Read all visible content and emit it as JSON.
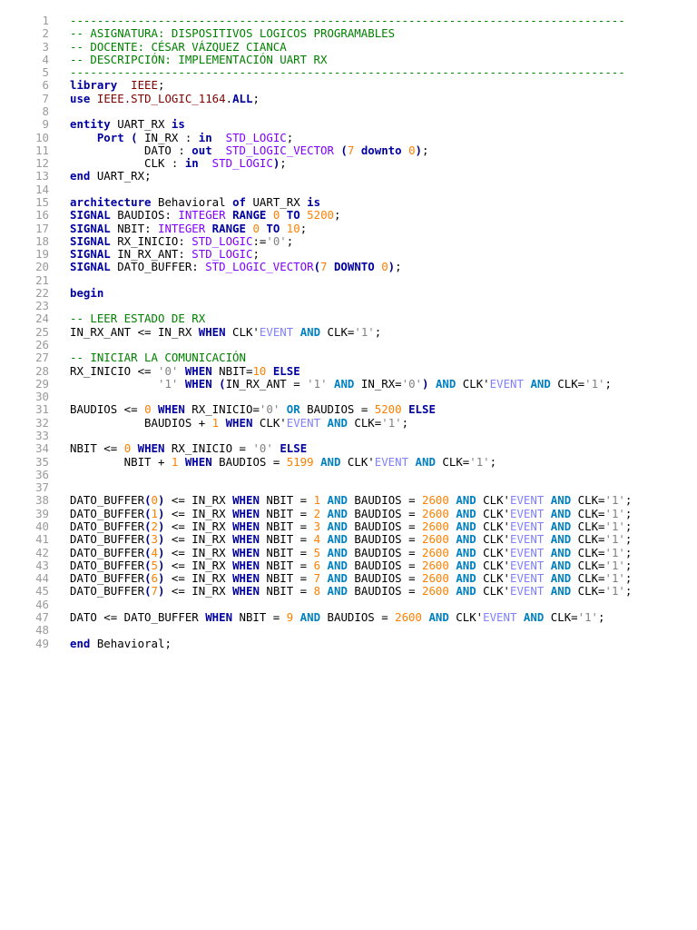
{
  "lines": [
    [
      [
        "c",
        "----------------------------------------------------------------------------------"
      ]
    ],
    [
      [
        "c",
        "-- ASIGNATURA: DISPOSITIVOS LOGICOS PROGRAMABLES"
      ]
    ],
    [
      [
        "c",
        "-- DOCENTE: CÉSAR VÁZQUEZ CIANCA"
      ]
    ],
    [
      [
        "c",
        "-- DESCRIPCIÓN: IMPLEMENTACIÓN UART RX"
      ]
    ],
    [
      [
        "c",
        "----------------------------------------------------------------------------------"
      ]
    ],
    [
      [
        "k",
        "library"
      ],
      [
        "",
        "  "
      ],
      [
        "l",
        "IEEE"
      ],
      [
        "",
        ";"
      ]
    ],
    [
      [
        "k",
        "use"
      ],
      [
        "",
        " "
      ],
      [
        "l",
        "IEEE.STD_LOGIC_1164"
      ],
      [
        "",
        "."
      ],
      [
        "k",
        "ALL"
      ],
      [
        "",
        ";"
      ]
    ],
    [],
    [
      [
        "k",
        "entity"
      ],
      [
        "",
        " UART_RX "
      ],
      [
        "k",
        "is"
      ]
    ],
    [
      [
        "",
        "    "
      ],
      [
        "k",
        "Port"
      ],
      [
        "",
        " "
      ],
      [
        "p",
        "("
      ],
      [
        "",
        " IN_RX : "
      ],
      [
        "k",
        "in"
      ],
      [
        "",
        "  "
      ],
      [
        "t",
        "STD_LOGIC"
      ],
      [
        "",
        ";"
      ]
    ],
    [
      [
        "",
        "           DATO : "
      ],
      [
        "k",
        "out"
      ],
      [
        "",
        "  "
      ],
      [
        "t",
        "STD_LOGIC_VECTOR"
      ],
      [
        "",
        " "
      ],
      [
        "p",
        "("
      ],
      [
        "n",
        "7"
      ],
      [
        "",
        " "
      ],
      [
        "k",
        "downto"
      ],
      [
        "",
        " "
      ],
      [
        "n",
        "0"
      ],
      [
        "p",
        ")"
      ],
      [
        "",
        ";"
      ]
    ],
    [
      [
        "",
        "           CLK : "
      ],
      [
        "k",
        "in"
      ],
      [
        "",
        "  "
      ],
      [
        "t",
        "STD_LOGIC"
      ],
      [
        "p",
        ")"
      ],
      [
        "",
        ";"
      ]
    ],
    [
      [
        "k",
        "end"
      ],
      [
        "",
        " UART_RX;"
      ]
    ],
    [],
    [
      [
        "k",
        "architecture"
      ],
      [
        "",
        " Behavioral "
      ],
      [
        "k",
        "of"
      ],
      [
        "",
        " UART_RX "
      ],
      [
        "k",
        "is"
      ]
    ],
    [
      [
        "k",
        "SIGNAL"
      ],
      [
        "",
        " BAUDIOS: "
      ],
      [
        "t",
        "INTEGER"
      ],
      [
        "",
        " "
      ],
      [
        "k",
        "RANGE"
      ],
      [
        "",
        " "
      ],
      [
        "n",
        "0"
      ],
      [
        "",
        " "
      ],
      [
        "k",
        "TO"
      ],
      [
        "",
        " "
      ],
      [
        "n",
        "5200"
      ],
      [
        "",
        ";"
      ]
    ],
    [
      [
        "k",
        "SIGNAL"
      ],
      [
        "",
        " NBIT: "
      ],
      [
        "t",
        "INTEGER"
      ],
      [
        "",
        " "
      ],
      [
        "k",
        "RANGE"
      ],
      [
        "",
        " "
      ],
      [
        "n",
        "0"
      ],
      [
        "",
        " "
      ],
      [
        "k",
        "TO"
      ],
      [
        "",
        " "
      ],
      [
        "n",
        "10"
      ],
      [
        "",
        ";"
      ]
    ],
    [
      [
        "k",
        "SIGNAL"
      ],
      [
        "",
        " RX_INICIO: "
      ],
      [
        "t",
        "STD_LOGIC"
      ],
      [
        "",
        ":="
      ],
      [
        "s",
        "'0'"
      ],
      [
        "",
        ";"
      ]
    ],
    [
      [
        "k",
        "SIGNAL"
      ],
      [
        "",
        " IN_RX_ANT: "
      ],
      [
        "t",
        "STD_LOGIC"
      ],
      [
        "",
        ";"
      ]
    ],
    [
      [
        "k",
        "SIGNAL"
      ],
      [
        "",
        " DATO_BUFFER: "
      ],
      [
        "t",
        "STD_LOGIC_VECTOR"
      ],
      [
        "p",
        "("
      ],
      [
        "n",
        "7"
      ],
      [
        "",
        " "
      ],
      [
        "k",
        "DOWNTO"
      ],
      [
        "",
        " "
      ],
      [
        "n",
        "0"
      ],
      [
        "p",
        ")"
      ],
      [
        "",
        ";"
      ]
    ],
    [],
    [
      [
        "k",
        "begin"
      ]
    ],
    [],
    [
      [
        "c",
        "-- LEER ESTADO DE RX"
      ]
    ],
    [
      [
        "",
        "IN_RX_ANT <= IN_RX "
      ],
      [
        "k",
        "WHEN"
      ],
      [
        "",
        " CLK'"
      ],
      [
        "e",
        "EVENT"
      ],
      [
        "",
        " "
      ],
      [
        "a",
        "AND"
      ],
      [
        "",
        " CLK="
      ],
      [
        "s",
        "'1'"
      ],
      [
        "",
        ";"
      ]
    ],
    [],
    [
      [
        "c",
        "-- INICIAR LA COMUNICACIÓN"
      ]
    ],
    [
      [
        "",
        "RX_INICIO <= "
      ],
      [
        "s",
        "'0'"
      ],
      [
        "",
        " "
      ],
      [
        "k",
        "WHEN"
      ],
      [
        "",
        " NBIT="
      ],
      [
        "n",
        "10"
      ],
      [
        "",
        " "
      ],
      [
        "k",
        "ELSE"
      ]
    ],
    [
      [
        "",
        "             "
      ],
      [
        "s",
        "'1'"
      ],
      [
        "",
        " "
      ],
      [
        "k",
        "WHEN"
      ],
      [
        "",
        " "
      ],
      [
        "p",
        "("
      ],
      [
        "",
        "IN_RX_ANT = "
      ],
      [
        "s",
        "'1'"
      ],
      [
        "",
        " "
      ],
      [
        "a",
        "AND"
      ],
      [
        "",
        " IN_RX="
      ],
      [
        "s",
        "'0'"
      ],
      [
        "p",
        ")"
      ],
      [
        "",
        " "
      ],
      [
        "a",
        "AND"
      ],
      [
        "",
        " CLK'"
      ],
      [
        "e",
        "EVENT"
      ],
      [
        "",
        " "
      ],
      [
        "a",
        "AND"
      ],
      [
        "",
        " CLK="
      ],
      [
        "s",
        "'1'"
      ],
      [
        "",
        ";"
      ]
    ],
    [],
    [
      [
        "",
        "BAUDIOS <= "
      ],
      [
        "n",
        "0"
      ],
      [
        "",
        " "
      ],
      [
        "k",
        "WHEN"
      ],
      [
        "",
        " RX_INICIO="
      ],
      [
        "s",
        "'0'"
      ],
      [
        "",
        " "
      ],
      [
        "a",
        "OR"
      ],
      [
        "",
        " BAUDIOS = "
      ],
      [
        "n",
        "5200"
      ],
      [
        "",
        " "
      ],
      [
        "k",
        "ELSE"
      ]
    ],
    [
      [
        "",
        "           BAUDIOS + "
      ],
      [
        "n",
        "1"
      ],
      [
        "",
        " "
      ],
      [
        "k",
        "WHEN"
      ],
      [
        "",
        " CLK'"
      ],
      [
        "e",
        "EVENT"
      ],
      [
        "",
        " "
      ],
      [
        "a",
        "AND"
      ],
      [
        "",
        " CLK="
      ],
      [
        "s",
        "'1'"
      ],
      [
        "",
        ";"
      ]
    ],
    [],
    [
      [
        "",
        "NBIT <= "
      ],
      [
        "n",
        "0"
      ],
      [
        "",
        " "
      ],
      [
        "k",
        "WHEN"
      ],
      [
        "",
        " RX_INICIO = "
      ],
      [
        "s",
        "'0'"
      ],
      [
        "",
        " "
      ],
      [
        "k",
        "ELSE"
      ]
    ],
    [
      [
        "",
        "        NBIT + "
      ],
      [
        "n",
        "1"
      ],
      [
        "",
        " "
      ],
      [
        "k",
        "WHEN"
      ],
      [
        "",
        " BAUDIOS = "
      ],
      [
        "n",
        "5199"
      ],
      [
        "",
        " "
      ],
      [
        "a",
        "AND"
      ],
      [
        "",
        " CLK'"
      ],
      [
        "e",
        "EVENT"
      ],
      [
        "",
        " "
      ],
      [
        "a",
        "AND"
      ],
      [
        "",
        " CLK="
      ],
      [
        "s",
        "'1'"
      ],
      [
        "",
        ";"
      ]
    ],
    [],
    [],
    [
      [
        "",
        "DATO_BUFFER"
      ],
      [
        "p",
        "("
      ],
      [
        "n",
        "0"
      ],
      [
        "p",
        ")"
      ],
      [
        "",
        " <= IN_RX "
      ],
      [
        "k",
        "WHEN"
      ],
      [
        "",
        " NBIT = "
      ],
      [
        "n",
        "1"
      ],
      [
        "",
        " "
      ],
      [
        "a",
        "AND"
      ],
      [
        "",
        " BAUDIOS = "
      ],
      [
        "n",
        "2600"
      ],
      [
        "",
        " "
      ],
      [
        "a",
        "AND"
      ],
      [
        "",
        " CLK'"
      ],
      [
        "e",
        "EVENT"
      ],
      [
        "",
        " "
      ],
      [
        "a",
        "AND"
      ],
      [
        "",
        " CLK="
      ],
      [
        "s",
        "'1'"
      ],
      [
        "",
        ";"
      ]
    ],
    [
      [
        "",
        "DATO_BUFFER"
      ],
      [
        "p",
        "("
      ],
      [
        "n",
        "1"
      ],
      [
        "p",
        ")"
      ],
      [
        "",
        " <= IN_RX "
      ],
      [
        "k",
        "WHEN"
      ],
      [
        "",
        " NBIT = "
      ],
      [
        "n",
        "2"
      ],
      [
        "",
        " "
      ],
      [
        "a",
        "AND"
      ],
      [
        "",
        " BAUDIOS = "
      ],
      [
        "n",
        "2600"
      ],
      [
        "",
        " "
      ],
      [
        "a",
        "AND"
      ],
      [
        "",
        " CLK'"
      ],
      [
        "e",
        "EVENT"
      ],
      [
        "",
        " "
      ],
      [
        "a",
        "AND"
      ],
      [
        "",
        " CLK="
      ],
      [
        "s",
        "'1'"
      ],
      [
        "",
        ";"
      ]
    ],
    [
      [
        "",
        "DATO_BUFFER"
      ],
      [
        "p",
        "("
      ],
      [
        "n",
        "2"
      ],
      [
        "p",
        ")"
      ],
      [
        "",
        " <= IN_RX "
      ],
      [
        "k",
        "WHEN"
      ],
      [
        "",
        " NBIT = "
      ],
      [
        "n",
        "3"
      ],
      [
        "",
        " "
      ],
      [
        "a",
        "AND"
      ],
      [
        "",
        " BAUDIOS = "
      ],
      [
        "n",
        "2600"
      ],
      [
        "",
        " "
      ],
      [
        "a",
        "AND"
      ],
      [
        "",
        " CLK'"
      ],
      [
        "e",
        "EVENT"
      ],
      [
        "",
        " "
      ],
      [
        "a",
        "AND"
      ],
      [
        "",
        " CLK="
      ],
      [
        "s",
        "'1'"
      ],
      [
        "",
        ";"
      ]
    ],
    [
      [
        "",
        "DATO_BUFFER"
      ],
      [
        "p",
        "("
      ],
      [
        "n",
        "3"
      ],
      [
        "p",
        ")"
      ],
      [
        "",
        " <= IN_RX "
      ],
      [
        "k",
        "WHEN"
      ],
      [
        "",
        " NBIT = "
      ],
      [
        "n",
        "4"
      ],
      [
        "",
        " "
      ],
      [
        "a",
        "AND"
      ],
      [
        "",
        " BAUDIOS = "
      ],
      [
        "n",
        "2600"
      ],
      [
        "",
        " "
      ],
      [
        "a",
        "AND"
      ],
      [
        "",
        " CLK'"
      ],
      [
        "e",
        "EVENT"
      ],
      [
        "",
        " "
      ],
      [
        "a",
        "AND"
      ],
      [
        "",
        " CLK="
      ],
      [
        "s",
        "'1'"
      ],
      [
        "",
        ";"
      ]
    ],
    [
      [
        "",
        "DATO_BUFFER"
      ],
      [
        "p",
        "("
      ],
      [
        "n",
        "4"
      ],
      [
        "p",
        ")"
      ],
      [
        "",
        " <= IN_RX "
      ],
      [
        "k",
        "WHEN"
      ],
      [
        "",
        " NBIT = "
      ],
      [
        "n",
        "5"
      ],
      [
        "",
        " "
      ],
      [
        "a",
        "AND"
      ],
      [
        "",
        " BAUDIOS = "
      ],
      [
        "n",
        "2600"
      ],
      [
        "",
        " "
      ],
      [
        "a",
        "AND"
      ],
      [
        "",
        " CLK'"
      ],
      [
        "e",
        "EVENT"
      ],
      [
        "",
        " "
      ],
      [
        "a",
        "AND"
      ],
      [
        "",
        " CLK="
      ],
      [
        "s",
        "'1'"
      ],
      [
        "",
        ";"
      ]
    ],
    [
      [
        "",
        "DATO_BUFFER"
      ],
      [
        "p",
        "("
      ],
      [
        "n",
        "5"
      ],
      [
        "p",
        ")"
      ],
      [
        "",
        " <= IN_RX "
      ],
      [
        "k",
        "WHEN"
      ],
      [
        "",
        " NBIT = "
      ],
      [
        "n",
        "6"
      ],
      [
        "",
        " "
      ],
      [
        "a",
        "AND"
      ],
      [
        "",
        " BAUDIOS = "
      ],
      [
        "n",
        "2600"
      ],
      [
        "",
        " "
      ],
      [
        "a",
        "AND"
      ],
      [
        "",
        " CLK'"
      ],
      [
        "e",
        "EVENT"
      ],
      [
        "",
        " "
      ],
      [
        "a",
        "AND"
      ],
      [
        "",
        " CLK="
      ],
      [
        "s",
        "'1'"
      ],
      [
        "",
        ";"
      ]
    ],
    [
      [
        "",
        "DATO_BUFFER"
      ],
      [
        "p",
        "("
      ],
      [
        "n",
        "6"
      ],
      [
        "p",
        ")"
      ],
      [
        "",
        " <= IN_RX "
      ],
      [
        "k",
        "WHEN"
      ],
      [
        "",
        " NBIT = "
      ],
      [
        "n",
        "7"
      ],
      [
        "",
        " "
      ],
      [
        "a",
        "AND"
      ],
      [
        "",
        " BAUDIOS = "
      ],
      [
        "n",
        "2600"
      ],
      [
        "",
        " "
      ],
      [
        "a",
        "AND"
      ],
      [
        "",
        " CLK'"
      ],
      [
        "e",
        "EVENT"
      ],
      [
        "",
        " "
      ],
      [
        "a",
        "AND"
      ],
      [
        "",
        " CLK="
      ],
      [
        "s",
        "'1'"
      ],
      [
        "",
        ";"
      ]
    ],
    [
      [
        "",
        "DATO_BUFFER"
      ],
      [
        "p",
        "("
      ],
      [
        "n",
        "7"
      ],
      [
        "p",
        ")"
      ],
      [
        "",
        " <= IN_RX "
      ],
      [
        "k",
        "WHEN"
      ],
      [
        "",
        " NBIT = "
      ],
      [
        "n",
        "8"
      ],
      [
        "",
        " "
      ],
      [
        "a",
        "AND"
      ],
      [
        "",
        " BAUDIOS = "
      ],
      [
        "n",
        "2600"
      ],
      [
        "",
        " "
      ],
      [
        "a",
        "AND"
      ],
      [
        "",
        " CLK'"
      ],
      [
        "e",
        "EVENT"
      ],
      [
        "",
        " "
      ],
      [
        "a",
        "AND"
      ],
      [
        "",
        " CLK="
      ],
      [
        "s",
        "'1'"
      ],
      [
        "",
        ";"
      ]
    ],
    [],
    [
      [
        "",
        "DATO <= DATO_BUFFER "
      ],
      [
        "k",
        "WHEN"
      ],
      [
        "",
        " NBIT = "
      ],
      [
        "n",
        "9"
      ],
      [
        "",
        " "
      ],
      [
        "a",
        "AND"
      ],
      [
        "",
        " BAUDIOS = "
      ],
      [
        "n",
        "2600"
      ],
      [
        "",
        " "
      ],
      [
        "a",
        "AND"
      ],
      [
        "",
        " CLK'"
      ],
      [
        "e",
        "EVENT"
      ],
      [
        "",
        " "
      ],
      [
        "a",
        "AND"
      ],
      [
        "",
        " CLK="
      ],
      [
        "s",
        "'1'"
      ],
      [
        "",
        ";"
      ]
    ],
    [],
    [
      [
        "k",
        "end"
      ],
      [
        "",
        " Behavioral;"
      ]
    ]
  ]
}
